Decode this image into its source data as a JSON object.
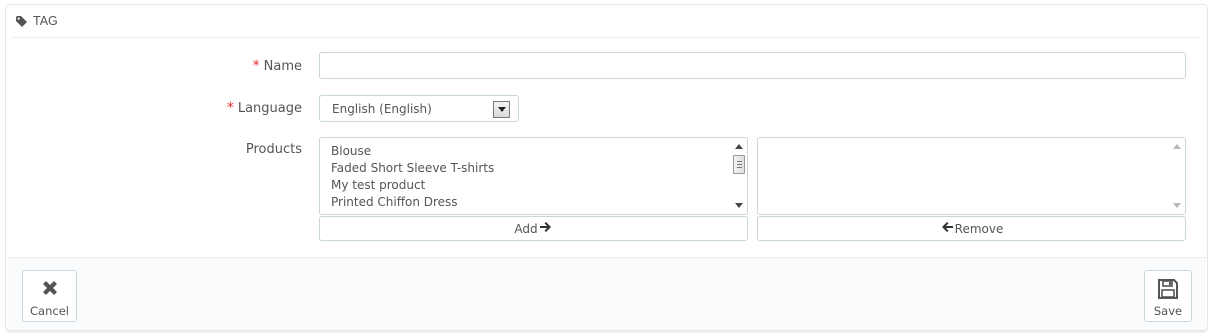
{
  "panel": {
    "heading_icon": "tag-icon",
    "title": "TAG"
  },
  "form": {
    "name": {
      "required_mark": "*",
      "label": "Name",
      "value": "",
      "placeholder": ""
    },
    "language": {
      "required_mark": "*",
      "label": "Language",
      "selected": "English (English)"
    },
    "products": {
      "label": "Products",
      "available": [
        "Blouse",
        "Faded Short Sleeve T-shirts",
        "My test product",
        "Printed Chiffon Dress"
      ],
      "selected": [],
      "add_label": "Add",
      "add_icon": "arrow-right-icon",
      "remove_label": "Remove",
      "remove_icon": "arrow-left-icon"
    }
  },
  "footer": {
    "cancel_label": "Cancel",
    "cancel_icon": "close-icon",
    "save_label": "Save",
    "save_icon": "floppy-disk-icon"
  },
  "colors": {
    "required": "#e32f2f",
    "border": "#c7d6db",
    "text": "#555555"
  }
}
